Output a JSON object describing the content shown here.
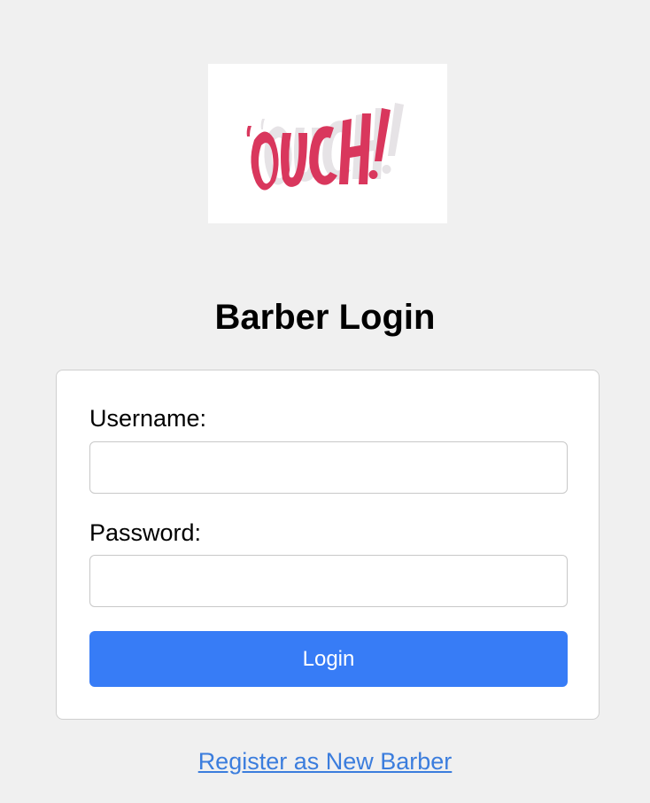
{
  "logo": {
    "text": "OUCH!",
    "icon": "ouch-logo-image",
    "color": "#d9375d"
  },
  "title": "Barber Login",
  "form": {
    "username_label": "Username:",
    "username_value": "",
    "password_label": "Password:",
    "password_value": "",
    "submit_label": "Login"
  },
  "register_link": "Register as New Barber",
  "colors": {
    "background": "#f0f0f0",
    "card": "#ffffff",
    "accent": "#377cf6",
    "link": "#3b7ddd"
  }
}
